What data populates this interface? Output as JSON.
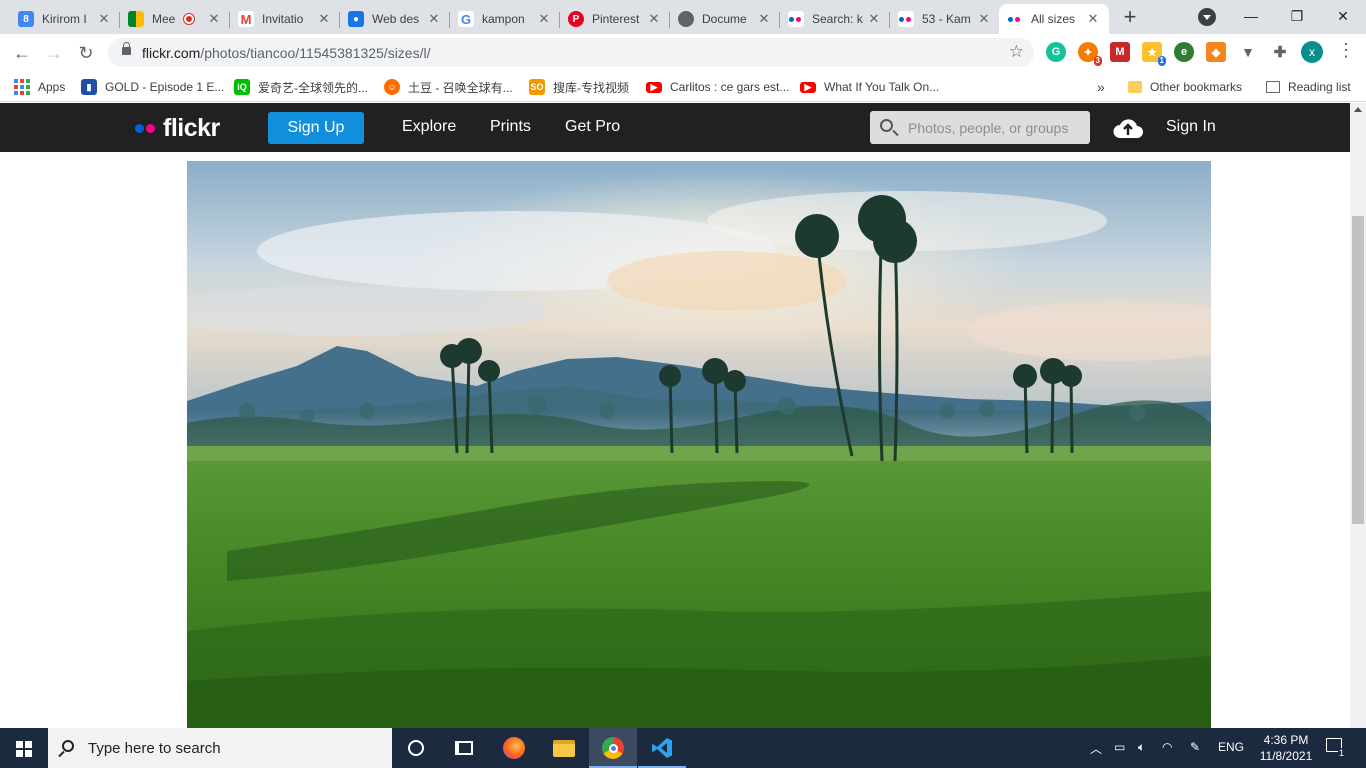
{
  "tabs": [
    {
      "title": "Kirirom I",
      "favicon": "google-sites-icon",
      "color": "#4285f4"
    },
    {
      "title": "Mee",
      "favicon": "google-meet-icon",
      "color": "#00897b"
    },
    {
      "title": "Invitatio",
      "favicon": "gmail-icon",
      "color": "#ea4335"
    },
    {
      "title": "Web des",
      "favicon": "google-contacts-icon",
      "color": "#1a73e8"
    },
    {
      "title": "kampon",
      "favicon": "google-search-icon",
      "color": "#4285f4"
    },
    {
      "title": "Pinterest",
      "favicon": "pinterest-icon",
      "color": "#e60023"
    },
    {
      "title": "Docume",
      "favicon": "globe-icon",
      "color": "#5f6368"
    },
    {
      "title": "Search: k",
      "favicon": "flickr-icon",
      "color": "#0063dc"
    },
    {
      "title": "53 - Kam",
      "favicon": "flickr-icon",
      "color": "#0063dc"
    },
    {
      "title": "All sizes",
      "favicon": "flickr-icon",
      "color": "#0063dc"
    }
  ],
  "window": {
    "minimize": "—",
    "restore": "❐",
    "close": "✕"
  },
  "toolbar": {
    "url_host": "flickr.com",
    "url_path": "/photos/tiancoo/11545381325/sizes/l/",
    "profile_initial": "x",
    "ext_badge_1": "3",
    "ext_badge_2": "1"
  },
  "bookmarks": [
    {
      "label": "Apps",
      "icon": "apps-grid-icon"
    },
    {
      "label": "GOLD - Episode 1 E...",
      "icon": "bookmark-gold-icon",
      "color": "#1f4fa8"
    },
    {
      "label": "爱奇艺-全球领先的...",
      "icon": "iqiyi-icon",
      "color": "#00be06"
    },
    {
      "label": "土豆 - 召唤全球有...",
      "icon": "tudou-icon",
      "color": "#ff6a00"
    },
    {
      "label": "搜库-专找视频",
      "icon": "soku-icon",
      "color": "#f39800"
    },
    {
      "label": "Carlitos : ce gars est...",
      "icon": "youtube-icon",
      "color": "#ff0000"
    },
    {
      "label": "What If You Talk On...",
      "icon": "youtube-icon",
      "color": "#ff0000"
    }
  ],
  "bookmarks_right": {
    "overflow": "»",
    "other": "Other bookmarks",
    "reading": "Reading list"
  },
  "flickr": {
    "logo_text": "flickr",
    "signup": "Sign Up",
    "nav": [
      "Explore",
      "Prints",
      "Get Pro"
    ],
    "search_placeholder": "Photos, people, or groups",
    "signin": "Sign In",
    "colors": {
      "blue": "#0063dc",
      "pink": "#ff0084",
      "signup_bg": "#128fdc",
      "header_bg": "#212124"
    }
  },
  "taskbar": {
    "search_placeholder": "Type here to search",
    "language": "ENG",
    "time": "4:36 PM",
    "date": "11/8/2021",
    "notification_count": "1"
  }
}
